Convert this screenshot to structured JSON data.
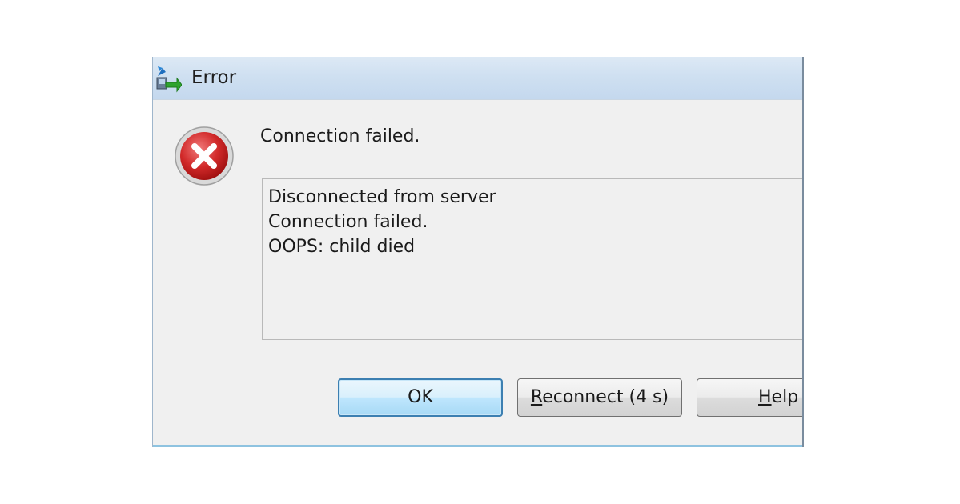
{
  "dialog": {
    "title": "Error",
    "app_icon": "network-connection-icon",
    "error_icon": "error-x-icon",
    "message": "Connection failed.",
    "details": [
      "Disconnected from server",
      "Connection failed.",
      "OOPS: child died"
    ],
    "buttons": {
      "ok": "OK",
      "reconnect_mnemonic": "R",
      "reconnect_rest": "econnect (4 s)",
      "help_mnemonic": "H",
      "help_rest": "elp"
    }
  },
  "colors": {
    "titlebar": "#cfe0f1",
    "dialog_bg": "#f0f0f0",
    "error_red": "#c81e1e",
    "focus_button_border": "#3c7fb1"
  }
}
